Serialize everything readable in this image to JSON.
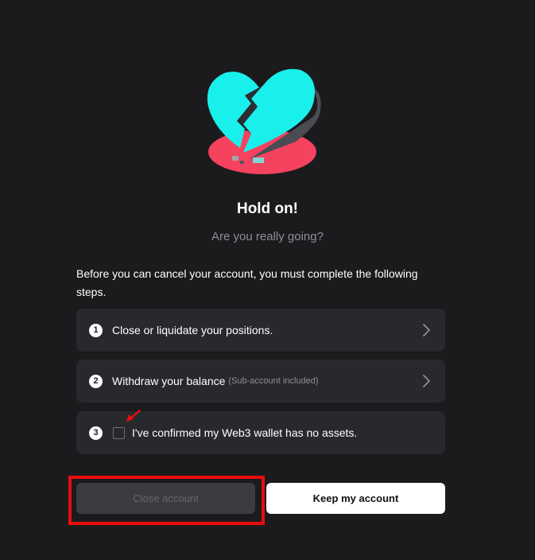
{
  "header": {
    "illustration": "broken-heart-icon",
    "title": "Hold on!",
    "subtitle": "Are you really going?"
  },
  "intro_text": "Before you can cancel your account, you must complete the following steps.",
  "steps": [
    {
      "number": "1",
      "label": "Close or liquidate your positions.",
      "note": "",
      "icon": "chevron-right-icon"
    },
    {
      "number": "2",
      "label": "Withdraw your balance",
      "note": "(Sub-account included)",
      "icon": "chevron-right-icon"
    },
    {
      "number": "3",
      "label": "I've confirmed my Web3 wallet has no assets.",
      "checked": false
    }
  ],
  "buttons": {
    "close": "Close account",
    "keep": "Keep my account"
  },
  "colors": {
    "background": "#1b1b1d",
    "card": "#28292d",
    "heart": "#10e8e8",
    "heart_base": "#f4425f",
    "annotation": "#ea0c0c",
    "disabled_button": "#3b3c40"
  }
}
